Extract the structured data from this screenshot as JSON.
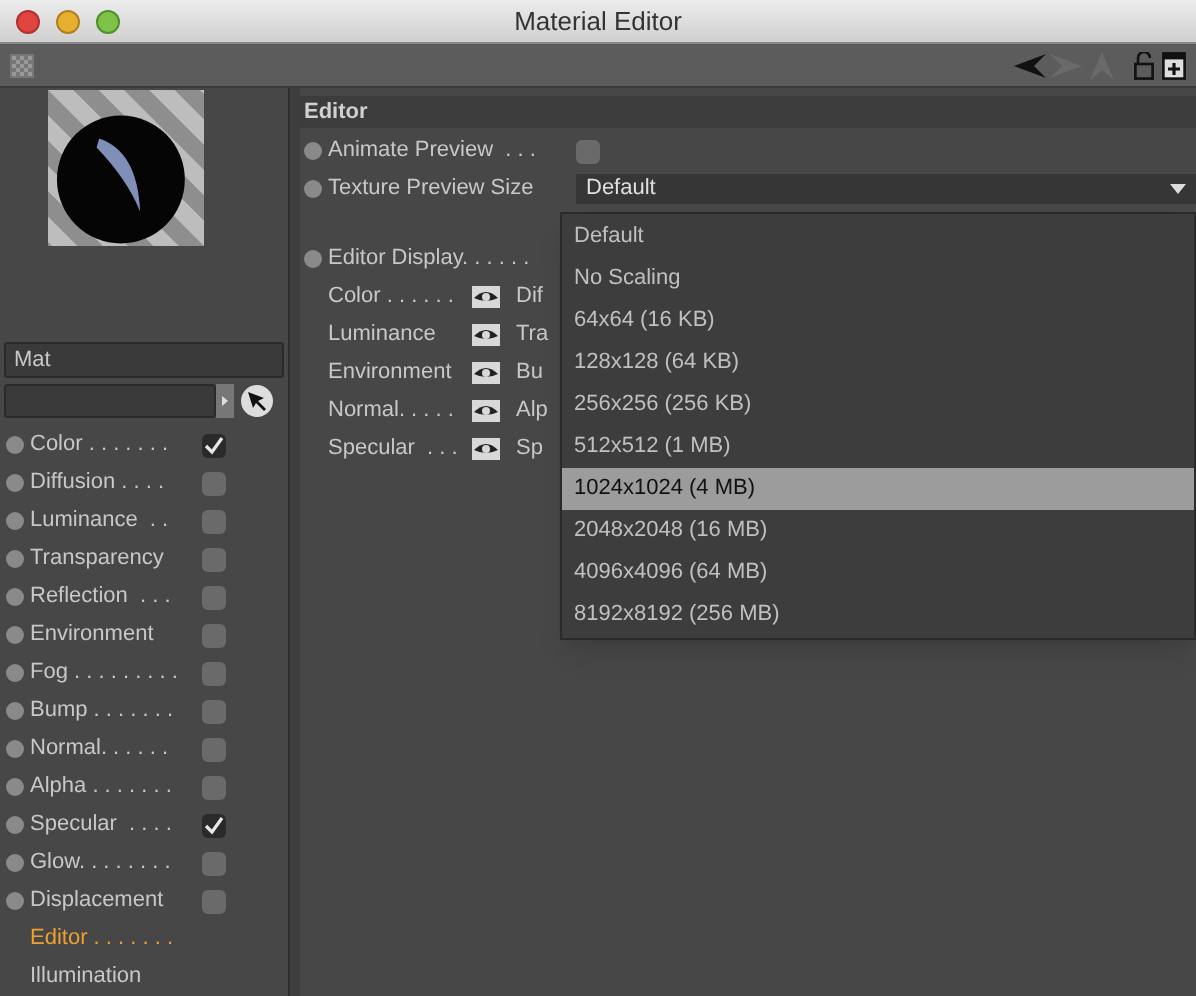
{
  "window": {
    "title": "Material Editor"
  },
  "material": {
    "name": "Mat"
  },
  "channels": [
    {
      "label": "Color . . . . . . .",
      "kind": "checkbox",
      "checked": true,
      "selected": false
    },
    {
      "label": "Diffusion . . . .",
      "kind": "checkbox",
      "checked": false,
      "selected": false
    },
    {
      "label": "Luminance  . .",
      "kind": "checkbox",
      "checked": false,
      "selected": false
    },
    {
      "label": "Transparency",
      "kind": "checkbox",
      "checked": false,
      "selected": false
    },
    {
      "label": "Reflection  . . .",
      "kind": "checkbox",
      "checked": false,
      "selected": false
    },
    {
      "label": "Environment",
      "kind": "checkbox",
      "checked": false,
      "selected": false
    },
    {
      "label": "Fog . . . . . . . . .",
      "kind": "checkbox",
      "checked": false,
      "selected": false
    },
    {
      "label": "Bump . . . . . . .",
      "kind": "checkbox",
      "checked": false,
      "selected": false
    },
    {
      "label": "Normal. . . . . .",
      "kind": "checkbox",
      "checked": false,
      "selected": false
    },
    {
      "label": "Alpha . . . . . . .",
      "kind": "checkbox",
      "checked": false,
      "selected": false
    },
    {
      "label": "Specular  . . . .",
      "kind": "checkbox",
      "checked": true,
      "selected": false
    },
    {
      "label": "Glow. . . . . . . .",
      "kind": "checkbox",
      "checked": false,
      "selected": false
    },
    {
      "label": "Displacement",
      "kind": "checkbox",
      "checked": false,
      "selected": false
    },
    {
      "label": "Editor . . . . . . .",
      "kind": "page",
      "selected": true
    },
    {
      "label": "Illumination",
      "kind": "page",
      "selected": false
    }
  ],
  "editor": {
    "title": "Editor",
    "animate_preview": {
      "label": "Animate Preview  . . .",
      "checked": false
    },
    "texture_preview_size": {
      "label": "Texture Preview Size",
      "value": "Default",
      "expanded": true,
      "options": [
        {
          "label": "Default",
          "highlighted": false
        },
        {
          "label": "No Scaling",
          "highlighted": false
        },
        {
          "label": "64x64 (16 KB)",
          "highlighted": false
        },
        {
          "label": "128x128 (64 KB)",
          "highlighted": false
        },
        {
          "label": "256x256 (256 KB)",
          "highlighted": false
        },
        {
          "label": "512x512 (1 MB)",
          "highlighted": false
        },
        {
          "label": "1024x1024 (4 MB)",
          "highlighted": true
        },
        {
          "label": "2048x2048 (16 MB)",
          "highlighted": false
        },
        {
          "label": "4096x4096 (64 MB)",
          "highlighted": false
        },
        {
          "label": "8192x8192 (256 MB)",
          "highlighted": false
        }
      ]
    },
    "editor_display": {
      "label": "Editor Display. . . . . .",
      "rows": [
        {
          "column_1": "Color . . . . . .",
          "column_2": "Dif"
        },
        {
          "column_1": "Luminance",
          "column_2": "Tra"
        },
        {
          "column_1": "Environment",
          "column_2": "Bu"
        },
        {
          "column_1": "Normal. . . . .",
          "column_2": "Alp"
        },
        {
          "column_1": "Specular  . . .",
          "column_2": "Sp"
        }
      ]
    }
  }
}
